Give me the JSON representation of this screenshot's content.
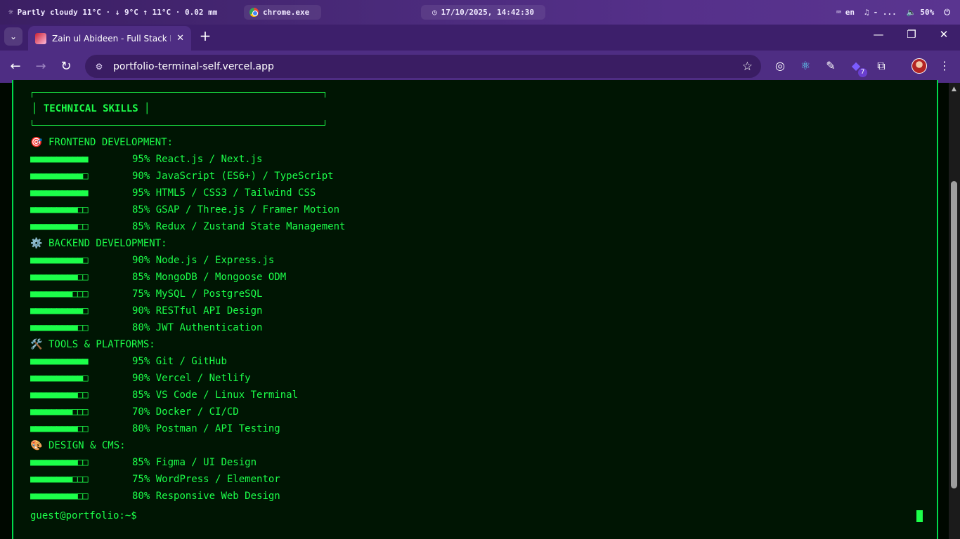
{
  "os": {
    "weather": "Partly cloudy 11°C · ↓ 9°C ↑ 11°C · 0.02 mm",
    "active_app": "chrome.exe",
    "datetime": "17/10/2025, 14:42:30",
    "language": "en",
    "media": "- ...",
    "volume": "50%"
  },
  "browser": {
    "tab_title": "Zain ul Abideen - Full Stack Dev",
    "url": "portfolio-terminal-self.vercel.app",
    "extensions_badge": "7"
  },
  "terminal": {
    "section_title": "TECHNICAL SKILLS",
    "categories": [
      {
        "title": "FRONTEND DEVELOPMENT:",
        "icon": "🎯",
        "skills": [
          {
            "bar": "■■■■■■■■■■■",
            "percent": "95%",
            "name": "React.js / Next.js"
          },
          {
            "bar": "■■■■■■■■■■□",
            "percent": "90%",
            "name": "JavaScript (ES6+) / TypeScript"
          },
          {
            "bar": "■■■■■■■■■■■",
            "percent": "95%",
            "name": "HTML5 / CSS3 / Tailwind CSS"
          },
          {
            "bar": "■■■■■■■■■□□",
            "percent": "85%",
            "name": "GSAP / Three.js / Framer Motion"
          },
          {
            "bar": "■■■■■■■■■□□",
            "percent": "85%",
            "name": "Redux / Zustand State Management"
          }
        ]
      },
      {
        "title": "BACKEND DEVELOPMENT:",
        "icon": "⚙️",
        "skills": [
          {
            "bar": "■■■■■■■■■■□",
            "percent": "90%",
            "name": "Node.js / Express.js"
          },
          {
            "bar": "■■■■■■■■■□□",
            "percent": "85%",
            "name": "MongoDB / Mongoose ODM"
          },
          {
            "bar": "■■■■■■■■□□□",
            "percent": "75%",
            "name": "MySQL / PostgreSQL"
          },
          {
            "bar": "■■■■■■■■■■□",
            "percent": "90%",
            "name": "RESTful API Design"
          },
          {
            "bar": "■■■■■■■■■□□",
            "percent": "80%",
            "name": "JWT Authentication"
          }
        ]
      },
      {
        "title": "TOOLS & PLATFORMS:",
        "icon": "🛠️",
        "skills": [
          {
            "bar": "■■■■■■■■■■■",
            "percent": "95%",
            "name": "Git / GitHub"
          },
          {
            "bar": "■■■■■■■■■■□",
            "percent": "90%",
            "name": "Vercel / Netlify"
          },
          {
            "bar": "■■■■■■■■■□□",
            "percent": "85%",
            "name": "VS Code / Linux Terminal"
          },
          {
            "bar": "■■■■■■■■□□□",
            "percent": "70%",
            "name": "Docker / CI/CD"
          },
          {
            "bar": "■■■■■■■■■□□",
            "percent": "80%",
            "name": "Postman / API Testing"
          }
        ]
      },
      {
        "title": "DESIGN & CMS:",
        "icon": "🎨",
        "skills": [
          {
            "bar": "■■■■■■■■■□□",
            "percent": "85%",
            "name": "Figma / UI Design"
          },
          {
            "bar": "■■■■■■■■□□□",
            "percent": "75%",
            "name": "WordPress / Elementor"
          },
          {
            "bar": "■■■■■■■■■□□",
            "percent": "80%",
            "name": "Responsive Web Design"
          }
        ]
      }
    ],
    "prompt": "guest@portfolio:~$"
  },
  "colors": {
    "terminal_text": "#1cff4a",
    "terminal_bg": "#001503",
    "browser_frame": "#4e2d83"
  }
}
